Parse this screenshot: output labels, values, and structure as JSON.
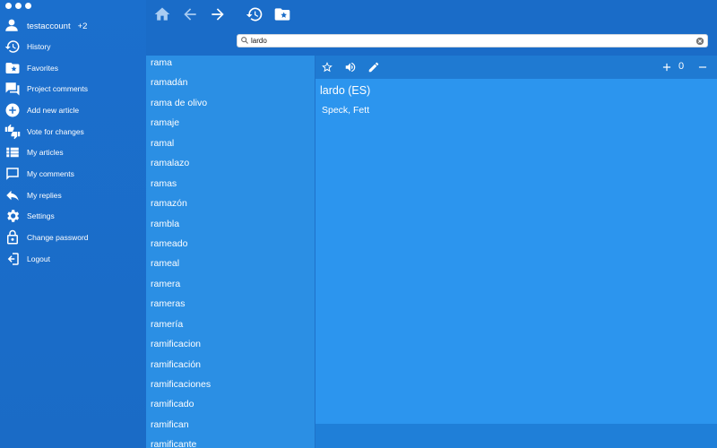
{
  "sidebar": {
    "account": "testaccount",
    "account_badge": "+2",
    "items": [
      {
        "label": "History",
        "icon": "history-icon"
      },
      {
        "label": "Favorites",
        "icon": "favorites-folder-icon"
      },
      {
        "label": "Project comments",
        "icon": "chat-icon"
      },
      {
        "label": "Add new article",
        "icon": "add-circle-icon"
      },
      {
        "label": "Vote for changes",
        "icon": "thumbs-icon"
      },
      {
        "label": "My articles",
        "icon": "list-icon"
      },
      {
        "label": "My comments",
        "icon": "comment-icon"
      },
      {
        "label": "My replies",
        "icon": "reply-icon"
      },
      {
        "label": "Settings",
        "icon": "gear-icon"
      },
      {
        "label": "Change password",
        "icon": "lock-icon"
      },
      {
        "label": "Logout",
        "icon": "logout-icon"
      }
    ]
  },
  "search": {
    "value": "lardo"
  },
  "wordlist": [
    "rama",
    "ramadán",
    "rama de olivo",
    "ramaje",
    "ramal",
    "ramalazo",
    "ramas",
    "ramazón",
    "rambla",
    "rameado",
    "rameal",
    "ramera",
    "rameras",
    "ramería",
    "ramificacion",
    "ramificación",
    "ramificaciones",
    "ramificado",
    "ramifican",
    "ramificante"
  ],
  "detail": {
    "headword": "lardo (ES)",
    "translation": "Speck, Fett",
    "counter": "0"
  },
  "colors": {
    "sidebar": "#1b6fcd",
    "list": "#2b8fe4",
    "detail": "#2c95ee"
  }
}
